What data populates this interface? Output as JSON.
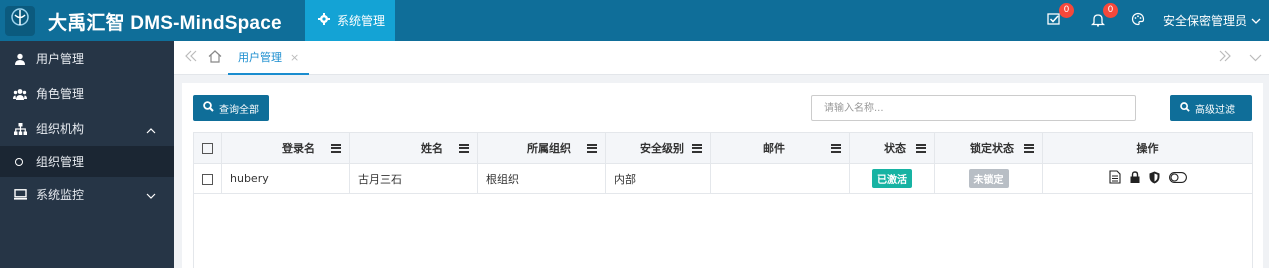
{
  "app": {
    "title": "大禹汇智 DMS-MindSpace",
    "logo_text": "大禹汇智"
  },
  "top_menu": {
    "label": "系统管理"
  },
  "header": {
    "tasks_count": "0",
    "notifications_count": "0",
    "user_label": "安全保密管理员"
  },
  "sidebar": {
    "items": [
      {
        "label": "用户管理",
        "icon": "user-icon"
      },
      {
        "label": "角色管理",
        "icon": "users-icon"
      },
      {
        "label": "组织机构",
        "icon": "sitemap-icon",
        "expanded": true
      },
      {
        "label": "系统监控",
        "icon": "monitor-icon",
        "expanded": false
      }
    ],
    "sub_items": [
      {
        "label": "组织管理"
      }
    ]
  },
  "tabs": [
    {
      "label": "用户管理",
      "close": "×"
    }
  ],
  "toolbar": {
    "query_all_label": "查询全部",
    "search_placeholder": "请输入名称...",
    "advanced_filter_label": "高级过滤"
  },
  "table": {
    "columns": [
      "登录名",
      "姓名",
      "所属组织",
      "安全级别",
      "邮件",
      "状态",
      "锁定状态",
      "操作"
    ],
    "rows": [
      {
        "login": "hubery",
        "name": "古月三石",
        "org": "根组织",
        "security_level": "内部",
        "email": "",
        "status": "已激活",
        "lock_status": "未锁定"
      }
    ]
  },
  "colors": {
    "header": "#0f6e99",
    "active_menu": "#14a3d5",
    "sidebar": "#263546",
    "status_active": "#17b3a3",
    "status_unlocked": "#b8bec5",
    "badge": "#f5483b"
  }
}
